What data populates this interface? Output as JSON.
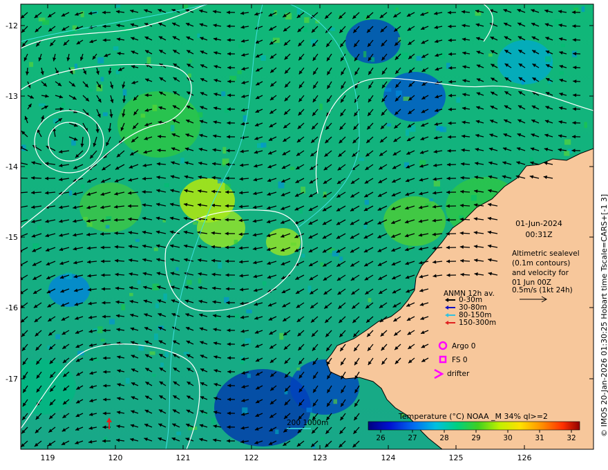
{
  "map": {
    "lon_ticks": [
      "119",
      "120",
      "121",
      "122",
      "123",
      "124",
      "125",
      "126"
    ],
    "lat_ticks": [
      "-12",
      "-13",
      "-14",
      "-15",
      "-16",
      "-17"
    ],
    "date": "01-Jun-2024",
    "time": "00:31Z",
    "sealevel_note": [
      "Altimetric sealevel",
      "(0.1m contours)",
      "and velocity for",
      "01 Jun 00Z"
    ],
    "scale_label": "0.5m/s (1kt 24h)",
    "anmn_title": "ANMN 12h av.",
    "anmn_depths": [
      {
        "label": "0-30m",
        "color": "#000000"
      },
      {
        "label": "30-80m",
        "color": "#1010c0"
      },
      {
        "label": "80-150m",
        "color": "#30c0e0"
      },
      {
        "label": "150-300m",
        "color": "#e02020"
      }
    ],
    "argo_label": "Argo 0",
    "fs_label": "FS 0",
    "drifter_label": "drifter",
    "bathy_label": "200  1000m",
    "colorbar_title": "Temperature (°C) NOAA _M 34% ql>=2",
    "colorbar_ticks": [
      "26",
      "27",
      "28",
      "29",
      "30",
      "31",
      "32"
    ],
    "credit": "© IMOS 20-Jan-2026 01:30:25 Hobart time Tscale=CARS+[-1 3]",
    "colors": {
      "land": "#f7c79b",
      "marker_magenta": "#ff00ff",
      "contour_white": "#ffffff",
      "bathy_cyan": "#40e0e0"
    }
  }
}
